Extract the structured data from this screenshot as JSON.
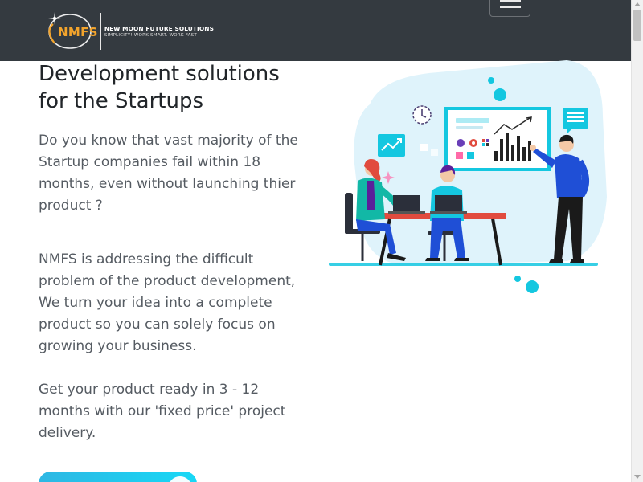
{
  "header": {
    "logo_mark": "NMFS",
    "company_name": "NEW MOON FUTURE SOLUTIONS",
    "tagline": "SIMPLICITY! WORK SMART. WORK FAST",
    "menu_icon": "hamburger-icon"
  },
  "hero": {
    "title": "Development solutions for the Startups",
    "paragraph_1": "Do you know that vast majority of the Startup companies fail within 18 months, even without launching thier product ?",
    "paragraph_2": "NMFS is addressing the difficult problem of the product development, We turn your idea into a complete product so you can solely focus on growing your business.",
    "paragraph_3": "Get your product ready in 3 - 12 months with our 'fixed price' project delivery.",
    "illustration": "team-working-on-laptops-illustration"
  },
  "colors": {
    "navbar": "#343a40",
    "logo_accent": "#f3a42c",
    "cta_gradient_start": "#2eb7e3",
    "cta_gradient_end": "#17d8f6",
    "illustration_accent": "#14c7e0",
    "illustration_bg": "#dff3fb"
  }
}
